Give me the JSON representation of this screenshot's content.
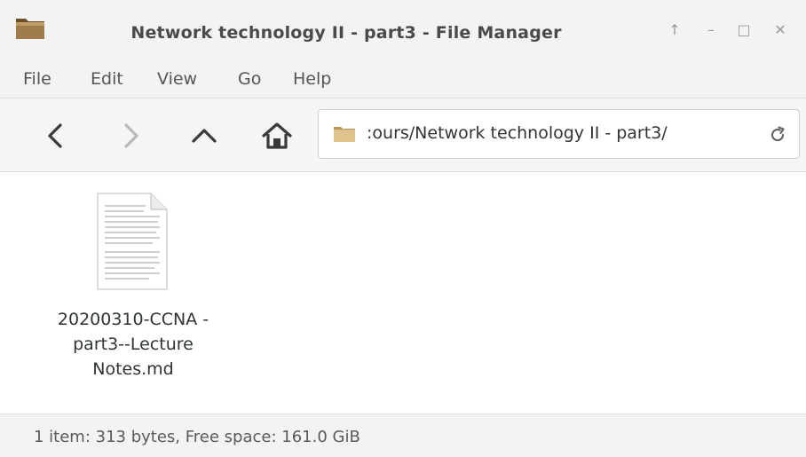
{
  "window": {
    "title": "Network technology II - part3 - File Manager",
    "controls": [
      "↑",
      "–",
      "□",
      "✕"
    ]
  },
  "menu": {
    "items": [
      "File",
      "Edit",
      "View",
      "Go",
      "Help"
    ]
  },
  "toolbar": {
    "location_text": ":ours/Network technology II - part3/",
    "icons": [
      "back-icon",
      "forward-icon",
      "up-icon",
      "home-icon",
      "folder-icon",
      "reload-icon"
    ]
  },
  "files": [
    {
      "name_lines": [
        "20200310-CCNA -",
        "part3--Lecture",
        "Notes.md"
      ],
      "icon": "text-file-icon"
    }
  ],
  "statusbar": {
    "text": "1 item: 313 bytes, Free space: 161.0 GiB"
  },
  "colors": {
    "folder": "#d9b87b",
    "folder_dark": "#b89556",
    "accent_gray": "#4a4a4a"
  }
}
